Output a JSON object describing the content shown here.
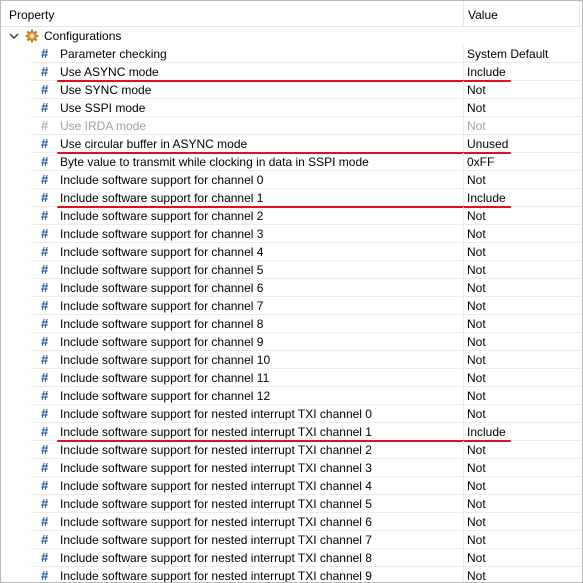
{
  "header": {
    "property_label": "Property",
    "value_label": "Value"
  },
  "group": {
    "label": "Configurations",
    "expanded": true,
    "icon": "gear-icon"
  },
  "colors": {
    "hash_icon": "#1f4f8c",
    "underline": "#e01020",
    "disabled_text": "#a0a0a0"
  },
  "rows": [
    {
      "label": "Parameter checking",
      "value": "System Default"
    },
    {
      "label": "Use ASYNC mode",
      "value": "Include",
      "highlighted": true
    },
    {
      "label": "Use SYNC mode",
      "value": "Not"
    },
    {
      "label": "Use SSPI mode",
      "value": "Not"
    },
    {
      "label": "Use IRDA mode",
      "value": "Not",
      "disabled": true
    },
    {
      "label": "Use circular buffer in ASYNC mode",
      "value": "Unused",
      "highlighted": true
    },
    {
      "label": "Byte value to transmit while clocking in data in SSPI mode",
      "value": "0xFF"
    },
    {
      "label": "Include software support for channel 0",
      "value": "Not"
    },
    {
      "label": "Include software support for channel 1",
      "value": "Include",
      "highlighted": true
    },
    {
      "label": "Include software support for channel 2",
      "value": "Not"
    },
    {
      "label": "Include software support for channel 3",
      "value": "Not"
    },
    {
      "label": "Include software support for channel 4",
      "value": "Not"
    },
    {
      "label": "Include software support for channel 5",
      "value": "Not"
    },
    {
      "label": "Include software support for channel 6",
      "value": "Not"
    },
    {
      "label": "Include software support for channel 7",
      "value": "Not"
    },
    {
      "label": "Include software support for channel 8",
      "value": "Not"
    },
    {
      "label": "Include software support for channel 9",
      "value": "Not"
    },
    {
      "label": "Include software support for channel 10",
      "value": "Not"
    },
    {
      "label": "Include software support for channel 11",
      "value": "Not"
    },
    {
      "label": "Include software support for channel 12",
      "value": "Not"
    },
    {
      "label": "Include software support for nested interrupt TXI channel 0",
      "value": "Not"
    },
    {
      "label": "Include software support for nested interrupt TXI channel 1",
      "value": "Include",
      "highlighted": true
    },
    {
      "label": "Include software support for nested interrupt TXI channel 2",
      "value": "Not"
    },
    {
      "label": "Include software support for nested interrupt TXI channel 3",
      "value": "Not"
    },
    {
      "label": "Include software support for nested interrupt TXI channel 4",
      "value": "Not"
    },
    {
      "label": "Include software support for nested interrupt TXI channel 5",
      "value": "Not"
    },
    {
      "label": "Include software support for nested interrupt TXI channel 6",
      "value": "Not"
    },
    {
      "label": "Include software support for nested interrupt TXI channel 7",
      "value": "Not"
    },
    {
      "label": "Include software support for nested interrupt TXI channel 8",
      "value": "Not"
    },
    {
      "label": "Include software support for nested interrupt TXI channel 9",
      "value": "Not"
    }
  ]
}
